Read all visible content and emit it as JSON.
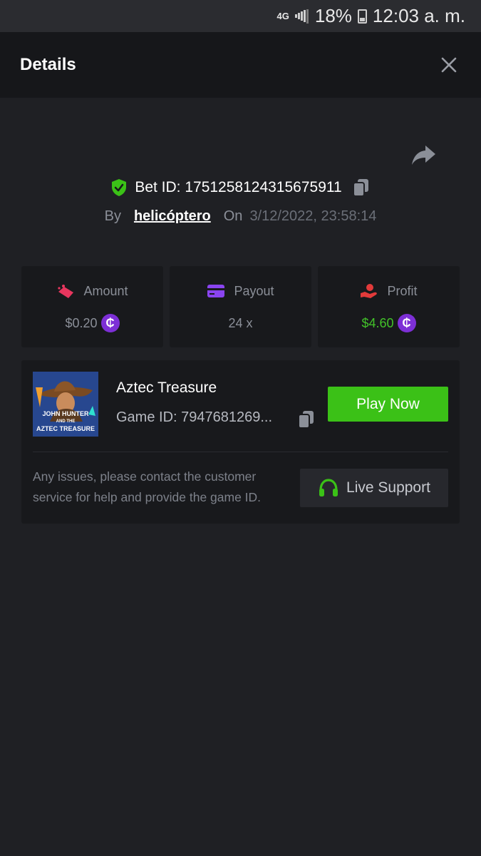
{
  "status_bar": {
    "network": "4G",
    "battery": "18%",
    "time": "12:03 a. m."
  },
  "header": {
    "title": "Details"
  },
  "bet": {
    "id_text": "Bet ID: 1751258124315675911",
    "by_label": "By",
    "username": "helicóptero",
    "on_label": "On",
    "date": "3/12/2022, 23:58:14"
  },
  "stats": [
    {
      "label": "Amount",
      "value": "$0.20",
      "icon": "amount-icon",
      "has_coin": true
    },
    {
      "label": "Payout",
      "value": "24 x",
      "icon": "card-icon",
      "has_coin": false
    },
    {
      "label": "Profit",
      "value": "$4.60",
      "icon": "profit-icon",
      "has_coin": true
    }
  ],
  "game": {
    "name": "Aztec Treasure",
    "game_id": "Game ID: 7947681269...",
    "thumb_text_line1": "JOHN HUNTER",
    "thumb_text_line2": "AND THE",
    "thumb_text_line3": "AZTEC TREASURE",
    "play_label": "Play Now",
    "notice": "Any issues, please contact the customer service for help and provide the game ID.",
    "support_label": "Live Support"
  },
  "colors": {
    "background": "#1f2024",
    "panel": "#18191c",
    "accent_green": "#3bc117",
    "profit_green": "#42c229",
    "coin_purple": "#7d2fd6",
    "amount_pink": "#e8365e",
    "payout_purple": "#8a44f0",
    "profit_red": "#e23a3a"
  }
}
